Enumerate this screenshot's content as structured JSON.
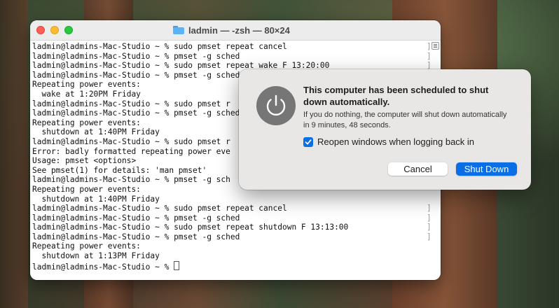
{
  "terminal": {
    "title": "ladmin — -zsh — 80×24",
    "lines": [
      {
        "text": "ladmin@ladmins-Mac-Studio ~ % sudo pmset repeat cancel",
        "mark": "]"
      },
      {
        "text": "ladmin@ladmins-Mac-Studio ~ % pmset -g sched",
        "mark": "]"
      },
      {
        "text": "ladmin@ladmins-Mac-Studio ~ % sudo pmset repeat wake F 13:20:00",
        "mark": "]"
      },
      {
        "text": "ladmin@ladmins-Mac-Studio ~ % pmset -g sched",
        "mark": ""
      },
      {
        "text": "Repeating power events:",
        "mark": ""
      },
      {
        "text": "  wake at 1:20PM Friday",
        "mark": ""
      },
      {
        "text": "ladmin@ladmins-Mac-Studio ~ % sudo pmset r",
        "mark": ""
      },
      {
        "text": "ladmin@ladmins-Mac-Studio ~ % pmset -g sched",
        "mark": ""
      },
      {
        "text": "Repeating power events:",
        "mark": ""
      },
      {
        "text": "  shutdown at 1:40PM Friday",
        "mark": ""
      },
      {
        "text": "ladmin@ladmins-Mac-Studio ~ % sudo pmset r",
        "mark": ""
      },
      {
        "text": "Error: badly formatted repeating power eve",
        "mark": ""
      },
      {
        "text": "Usage: pmset <options>",
        "mark": ""
      },
      {
        "text": "See pmset(1) for details: 'man pmset'",
        "mark": ""
      },
      {
        "text": "ladmin@ladmins-Mac-Studio ~ % pmset -g sch",
        "mark": ""
      },
      {
        "text": "Repeating power events:",
        "mark": ""
      },
      {
        "text": "  shutdown at 1:40PM Friday",
        "mark": ""
      },
      {
        "text": "ladmin@ladmins-Mac-Studio ~ % sudo pmset repeat cancel",
        "mark": "]"
      },
      {
        "text": "ladmin@ladmins-Mac-Studio ~ % pmset -g sched",
        "mark": "]"
      },
      {
        "text": "ladmin@ladmins-Mac-Studio ~ % sudo pmset repeat shutdown F 13:13:00",
        "mark": "]"
      },
      {
        "text": "ladmin@ladmins-Mac-Studio ~ % pmset -g sched",
        "mark": "]"
      },
      {
        "text": "Repeating power events:",
        "mark": ""
      },
      {
        "text": "  shutdown at 1:13PM Friday",
        "mark": ""
      }
    ],
    "prompt": "ladmin@ladmins-Mac-Studio ~ % "
  },
  "dialog": {
    "icon": "power-icon",
    "title": "This computer has been scheduled to shut down automatically.",
    "message": "If you do nothing, the computer will shut down automatically in 9 minutes, 48 seconds.",
    "checkbox_label": "Reopen windows when logging back in",
    "checkbox_checked": true,
    "cancel_label": "Cancel",
    "shutdown_label": "Shut Down"
  },
  "colors": {
    "accent": "#0a6fe6",
    "close": "#ff5f57",
    "minimize": "#febc2e",
    "maximize": "#28c840"
  }
}
